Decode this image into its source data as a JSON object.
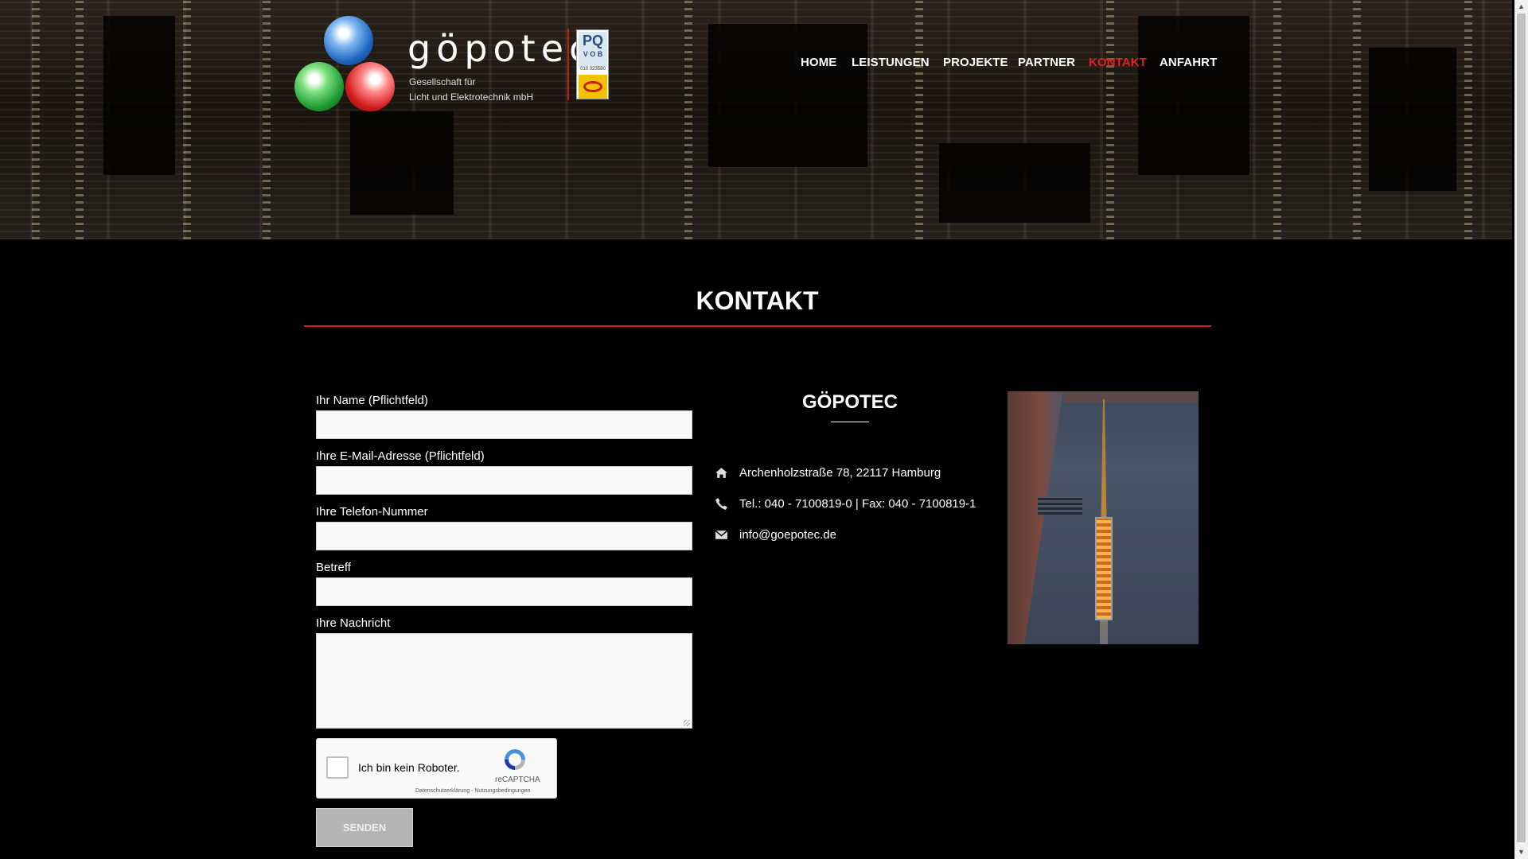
{
  "brand": {
    "name": "göpotec",
    "tagline_line1": "Gesellschaft für",
    "tagline_line2": "Licht und Elektrotechnik mbH",
    "badge_pq": "PQ",
    "badge_vob": "V O B",
    "badge_number": "010.023580"
  },
  "nav": {
    "items": [
      {
        "label": "HOME",
        "active": false
      },
      {
        "label": "LEISTUNGEN",
        "active": false
      },
      {
        "label": "PROJEKTE",
        "active": false
      },
      {
        "label": "PARTNER",
        "active": false
      },
      {
        "label": "KONTAKT",
        "active": true
      },
      {
        "label": "ANFAHRT",
        "active": false
      }
    ]
  },
  "page": {
    "title": "KONTAKT",
    "accent_color": "#d81c1c"
  },
  "form": {
    "name_label": "Ihr Name (Pflichtfeld)",
    "name_value": "",
    "email_label": "Ihre E-Mail-Adresse (Pflichtfeld)",
    "email_value": "",
    "phone_label": "Ihre Telefon-Nummer",
    "phone_value": "",
    "subject_label": "Betreff",
    "subject_value": "",
    "message_label": "Ihre Nachricht",
    "message_value": "",
    "submit_label": "SENDEN"
  },
  "recaptcha": {
    "label": "Ich bin kein Roboter.",
    "brand": "reCAPTCHA",
    "terms": "Datenschutzerklärung - Nutzungsbedingungen"
  },
  "company": {
    "title": "GÖPOTEC",
    "address": "Archenholzstraße 78, 22117 Hamburg",
    "phone": "Tel.: 040 - 7100819-0 | Fax: 040 - 7100819-1",
    "email": "info@goepotec.de",
    "address_icon": "home-icon",
    "phone_icon": "phone-icon",
    "email_icon": "envelope-icon"
  }
}
